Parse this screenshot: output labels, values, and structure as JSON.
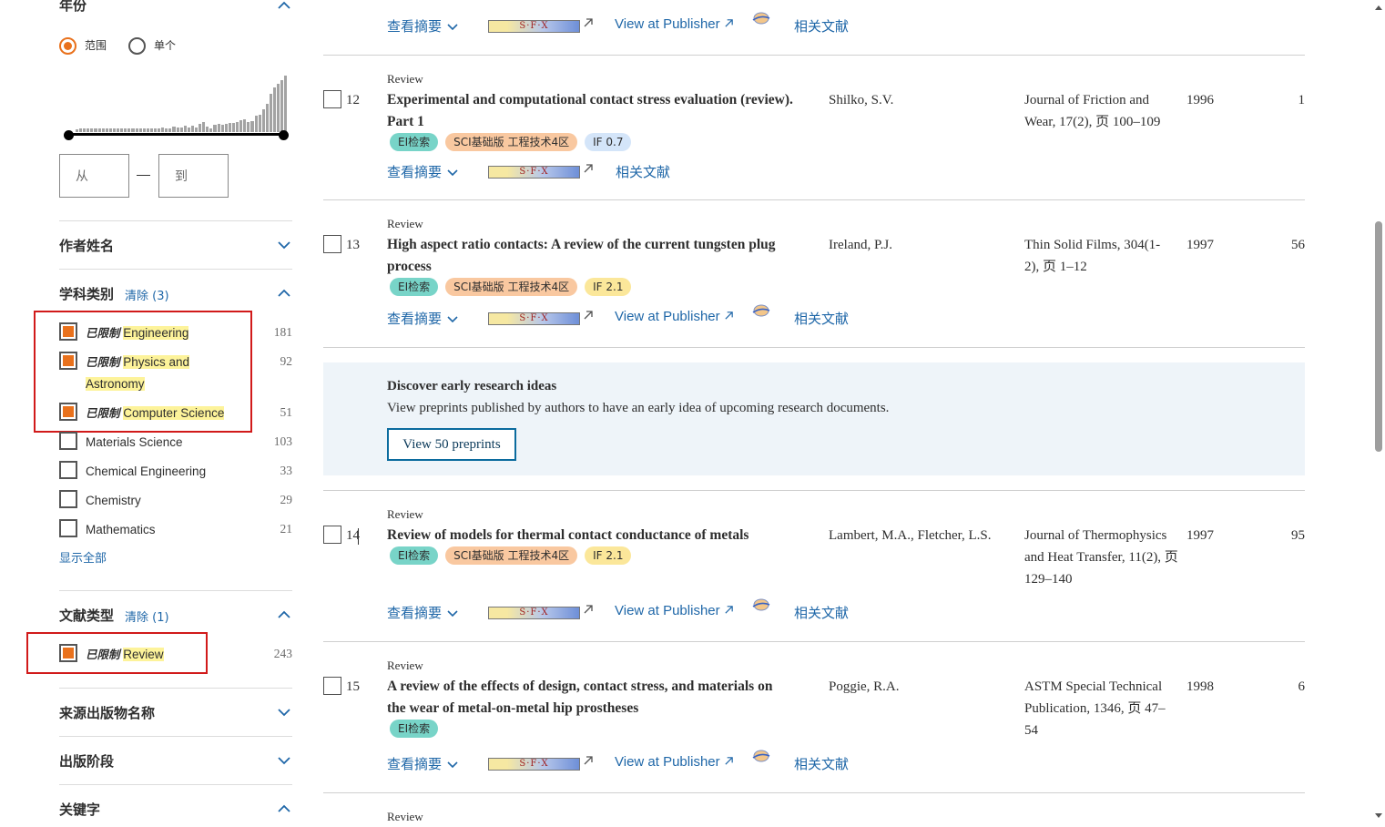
{
  "sidebar": {
    "year": {
      "title": "年份",
      "range_label": "范围",
      "single_label": "单个",
      "from_placeholder": "从",
      "to_placeholder": "到",
      "histogram": [
        3,
        4,
        4,
        4,
        4,
        4,
        4,
        4,
        4,
        4,
        4,
        4,
        4,
        4,
        4,
        4,
        4,
        4,
        4,
        4,
        5,
        5,
        5,
        6,
        4,
        5,
        7,
        6,
        6,
        8,
        6,
        8,
        6,
        10,
        12,
        7,
        5,
        9,
        10,
        9,
        10,
        11,
        11,
        13,
        15,
        16,
        12,
        14,
        20,
        22,
        28,
        35,
        48,
        55,
        60,
        64,
        70
      ]
    },
    "author": {
      "title": "作者姓名"
    },
    "subject": {
      "title": "学科类别",
      "clear": "清除 (3)",
      "limit_prefix": "已限制",
      "items": [
        {
          "label": "Engineering",
          "count": "181",
          "checked": true
        },
        {
          "label": "Physics and Astronomy",
          "label_l1": "Physics and",
          "label_l2": "Astronomy",
          "count": "92",
          "checked": true
        },
        {
          "label": "Computer Science",
          "count": "51",
          "checked": true
        },
        {
          "label": "Materials Science",
          "count": "103",
          "checked": false
        },
        {
          "label": "Chemical Engineering",
          "count": "33",
          "checked": false
        },
        {
          "label": "Chemistry",
          "count": "29",
          "checked": false
        },
        {
          "label": "Mathematics",
          "count": "21",
          "checked": false
        }
      ],
      "show_all": "显示全部"
    },
    "doctype": {
      "title": "文献类型",
      "clear": "清除 (1)",
      "limit_prefix": "已限制",
      "item_label": "Review",
      "item_count": "243"
    },
    "source_title": {
      "title": "来源出版物名称"
    },
    "pub_stage": {
      "title": "出版阶段"
    },
    "keyword": {
      "title": "关键字"
    }
  },
  "actions": {
    "abstract": "查看摘要",
    "sfx": "S·F·X",
    "publisher": "View at Publisher",
    "related": "相关文献"
  },
  "results": [
    {
      "type": "Review",
      "num": "12",
      "title": "Experimental and computational contact stress evaluation (review). Part 1",
      "authors": "Shilko, S.V.",
      "source": "Journal of Friction and Wear, 17(2), 页 100–109",
      "year": "1996",
      "cites": "1",
      "tags": [
        "EI检索",
        "SCI基础版 工程技术4区",
        "IF 0.7"
      ]
    },
    {
      "type": "Review",
      "num": "13",
      "title": "High aspect ratio contacts: A review of the current tungsten plug process",
      "authors": "Ireland, P.J.",
      "source": "Thin Solid Films, 304(1-2), 页 1–12",
      "year": "1997",
      "cites": "56",
      "tags": [
        "EI检索",
        "SCI基础版 工程技术4区",
        "IF 2.1"
      ]
    },
    {
      "type": "Review",
      "num": "14",
      "title": "Review of models for thermal contact conductance of metals",
      "authors": "Lambert, M.A., Fletcher, L.S.",
      "source": "Journal of Thermophysics and Heat Transfer, 11(2), 页 129–140",
      "year": "1997",
      "cites": "95",
      "tags": [
        "EI检索",
        "SCI基础版 工程技术4区",
        "IF 2.1"
      ]
    },
    {
      "type": "Review",
      "num": "15",
      "title": "A review of the effects of design, contact stress, and materials on the wear of metal-on-metal hip prostheses",
      "authors": "Poggie, R.A.",
      "source": "ASTM Special Technical Publication, 1346, 页 47–54",
      "year": "1998",
      "cites": "6",
      "tags": [
        "EI检索"
      ]
    },
    {
      "type": "Review"
    }
  ],
  "promo": {
    "title": "Discover early research ideas",
    "description": "View preprints published by authors to have an early idea of upcoming research documents.",
    "button": "View 50 preprints"
  },
  "colors": {
    "accent": "#e9711c",
    "link": "#1f67a8",
    "highlight": "#fdf39a",
    "annotation_box": "#d11a1a"
  }
}
